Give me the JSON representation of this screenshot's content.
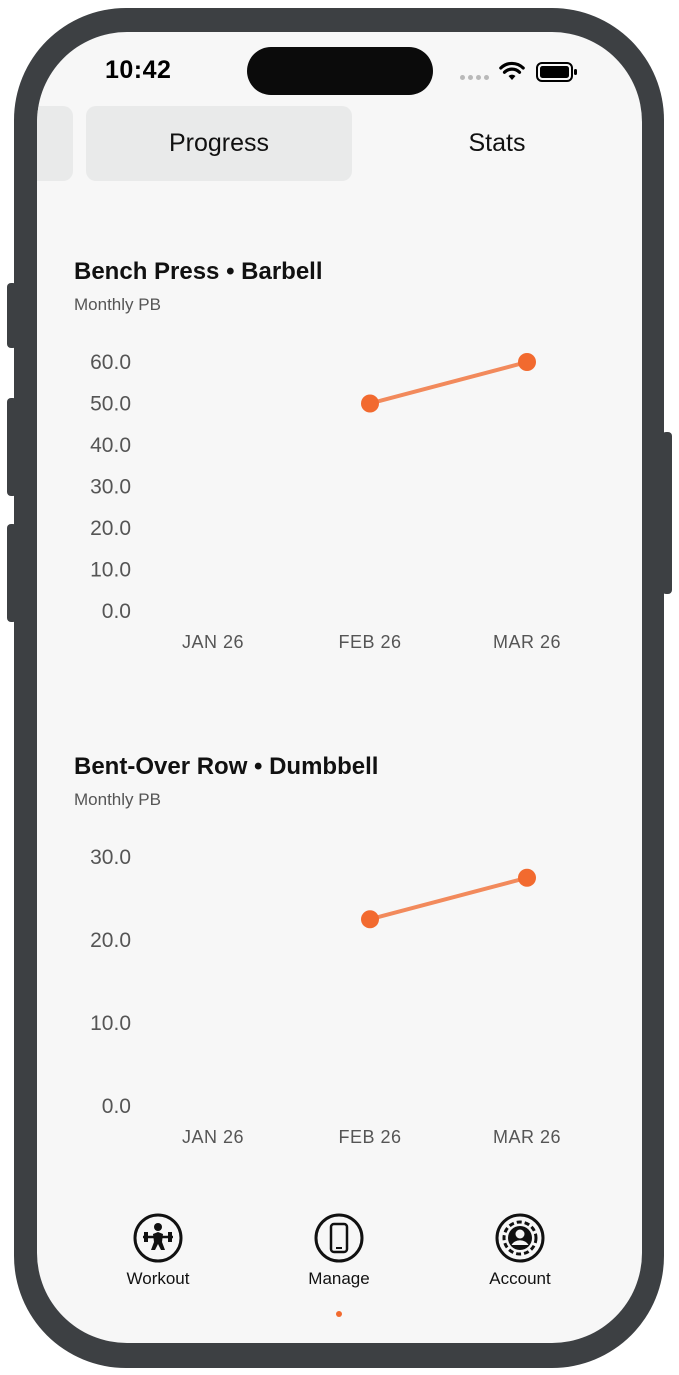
{
  "status_bar": {
    "time": "10:42"
  },
  "segments": [
    "",
    "Progress",
    "Stats"
  ],
  "charts": [
    {
      "title": "Bench Press • Barbell",
      "subtitle": "Monthly PB",
      "y_ticks": [
        "60.0",
        "50.0",
        "40.0",
        "30.0",
        "20.0",
        "10.0",
        "0.0"
      ],
      "x_ticks": [
        "JAN 26",
        "FEB 26",
        "MAR 26"
      ]
    },
    {
      "title": "Bent-Over Row • Dumbbell",
      "subtitle": "Monthly PB",
      "y_ticks": [
        "30.0",
        "20.0",
        "10.0",
        "0.0"
      ],
      "x_ticks": [
        "JAN 26",
        "FEB 26",
        "MAR 26"
      ]
    }
  ],
  "chart_data": [
    {
      "type": "line",
      "title": "Bench Press • Barbell",
      "categories": [
        "JAN 26",
        "FEB 26",
        "MAR 26"
      ],
      "values": [
        null,
        50,
        60
      ],
      "ylim": [
        0,
        60
      ],
      "grid": false,
      "color": "#f26a2f"
    },
    {
      "type": "line",
      "title": "Bent-Over Row • Dumbbell",
      "categories": [
        "JAN 26",
        "FEB 26",
        "MAR 26"
      ],
      "values": [
        null,
        22.5,
        27.5
      ],
      "ylim": [
        0,
        30
      ],
      "grid": false,
      "color": "#f26a2f"
    }
  ],
  "tabbar": {
    "items": [
      {
        "label": "Workout",
        "icon": "barbell-lifter-icon"
      },
      {
        "label": "Manage",
        "icon": "phone-icon"
      },
      {
        "label": "Account",
        "icon": "person-circle-icon"
      }
    ],
    "active_index": 1
  },
  "colors": {
    "accent": "#f26a2f",
    "frame": "#3d4043",
    "background": "#f7f7f7"
  }
}
